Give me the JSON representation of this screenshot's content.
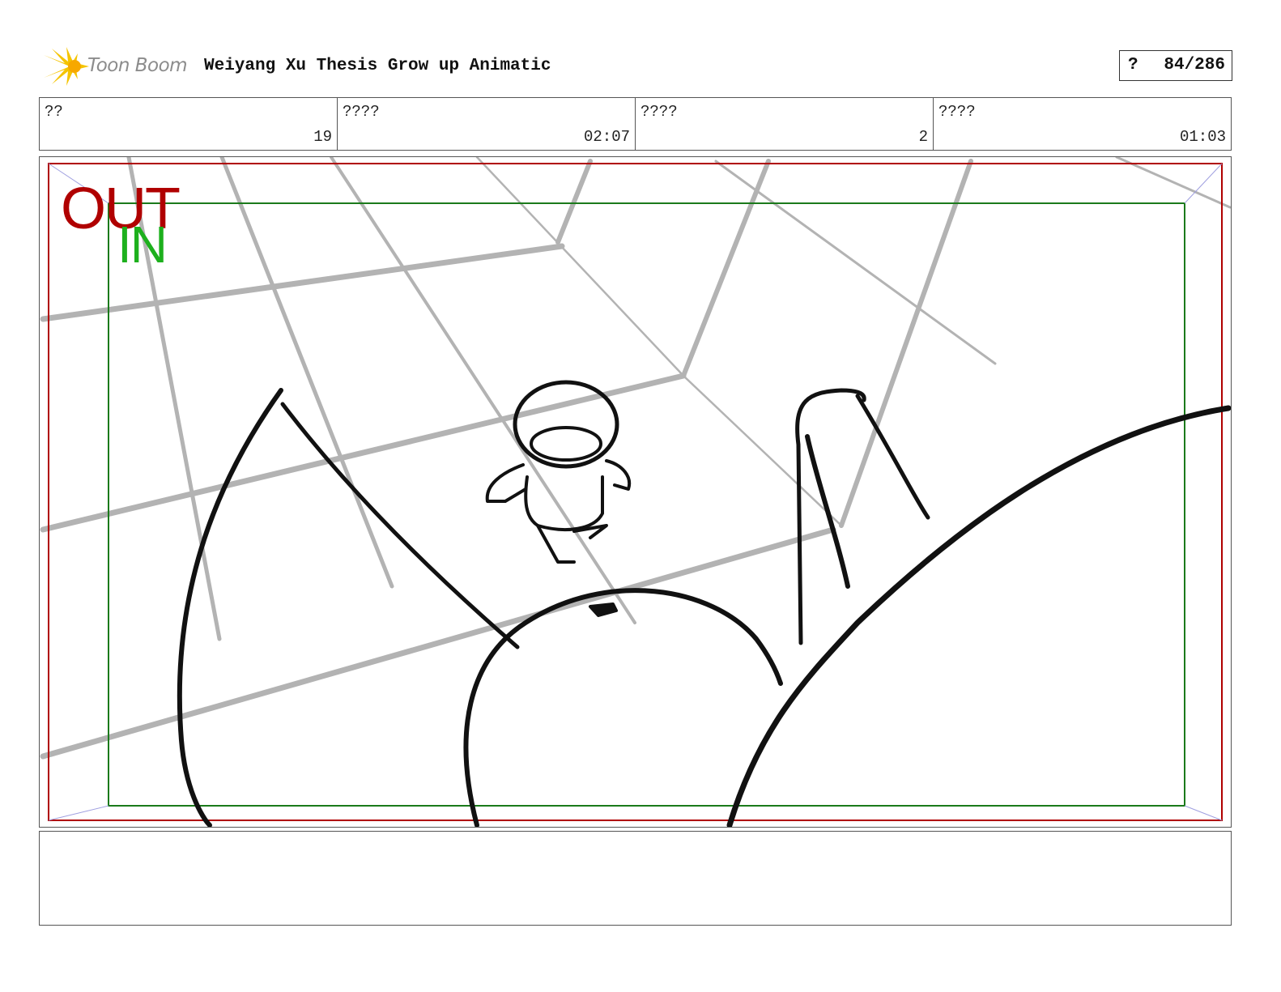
{
  "header": {
    "logo_text": "Toon Boom",
    "title": "Weiyang Xu Thesis Grow up Animatic",
    "page_marker": "?",
    "page_number": "84/286"
  },
  "info": [
    {
      "label": "??",
      "value": "19"
    },
    {
      "label": "????",
      "value": "02:07"
    },
    {
      "label": "????",
      "value": "2"
    },
    {
      "label": "????",
      "value": "01:03"
    }
  ],
  "panel": {
    "out_label": "OUT",
    "in_label": "IN",
    "colors": {
      "out_frame": "#b00000",
      "in_frame": "#1b7a1b",
      "grid_sketch": "#b3b3b3",
      "ink": "#111111"
    }
  },
  "notes": {
    "text": ""
  }
}
